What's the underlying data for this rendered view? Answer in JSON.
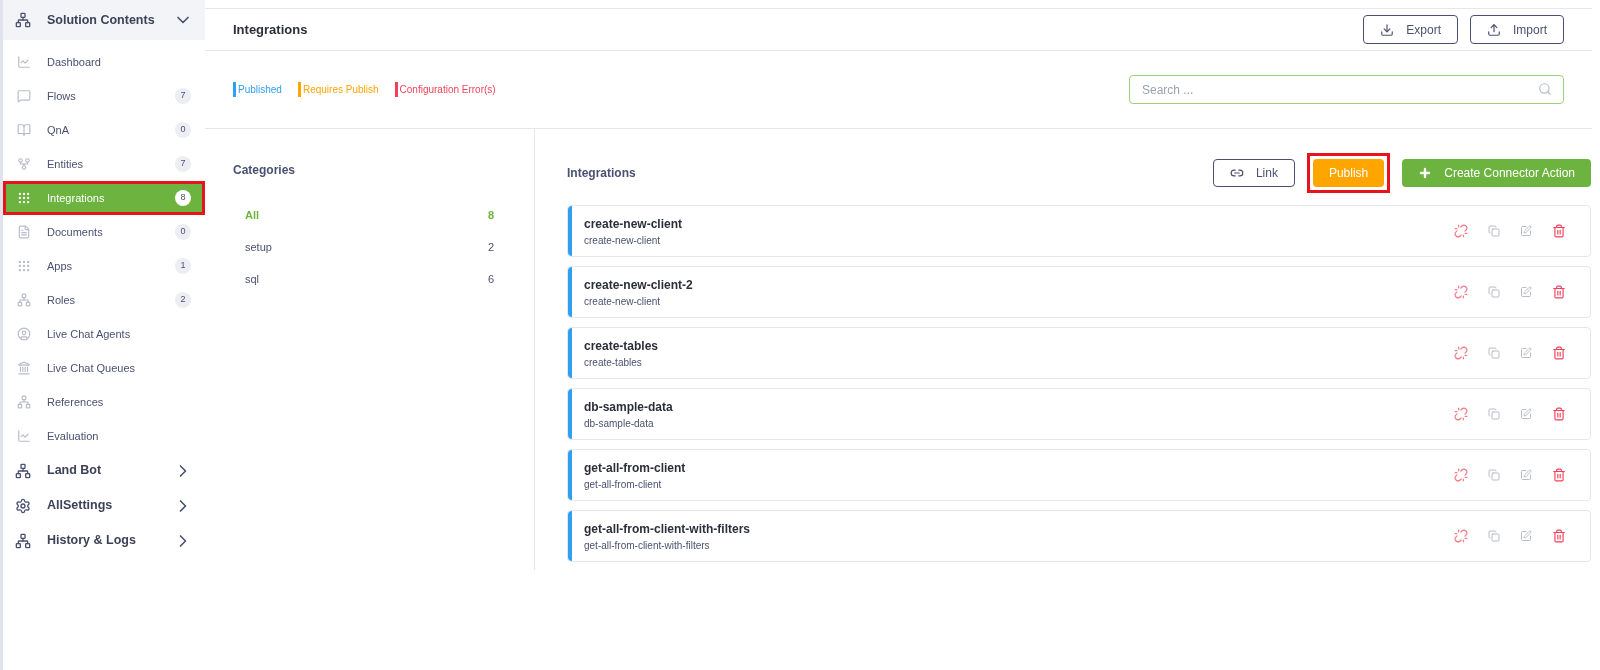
{
  "sidebar": {
    "sections": [
      {
        "title": "Solution Contents",
        "expanded": true,
        "items": [
          {
            "label": "Dashboard",
            "selected": false,
            "highlighted": false
          },
          {
            "label": "Flows",
            "count": "7",
            "selected": false,
            "highlighted": false
          },
          {
            "label": "QnA",
            "count": "0",
            "selected": false,
            "highlighted": false
          },
          {
            "label": "Entities",
            "count": "7",
            "selected": false,
            "highlighted": false
          },
          {
            "label": "Integrations",
            "count": "8",
            "selected": true,
            "highlighted": true
          },
          {
            "label": "Documents",
            "count": "0",
            "selected": false,
            "highlighted": false
          },
          {
            "label": "Apps",
            "count": "1",
            "selected": false,
            "highlighted": false
          },
          {
            "label": "Roles",
            "count": "2",
            "selected": false,
            "highlighted": false
          },
          {
            "label": "Live Chat Agents",
            "selected": false,
            "highlighted": false
          },
          {
            "label": "Live Chat Queues",
            "selected": false,
            "highlighted": false
          },
          {
            "label": "References",
            "selected": false,
            "highlighted": false
          },
          {
            "label": "Evaluation",
            "selected": false,
            "highlighted": false
          }
        ]
      },
      {
        "title": "Land Bot",
        "expanded": false
      },
      {
        "title": "AllSettings",
        "expanded": false
      },
      {
        "title": "History & Logs",
        "expanded": false
      }
    ]
  },
  "header": {
    "title": "Integrations",
    "buttons": [
      "Export",
      "Import"
    ]
  },
  "legend": [
    {
      "label": "Published",
      "color": "#2f9ff2"
    },
    {
      "label": "Requires Publish",
      "color": "#ffa500"
    },
    {
      "label": "Configuration Error(s)",
      "color": "#f0435a"
    }
  ],
  "search": {
    "placeholder": "Search ..."
  },
  "categories": {
    "title": "Categories",
    "items": [
      {
        "label": "All",
        "count": "8",
        "selected": true
      },
      {
        "label": "setup",
        "count": "2",
        "selected": false
      },
      {
        "label": "sql",
        "count": "6",
        "selected": false
      }
    ]
  },
  "integrations": {
    "title": "Integrations",
    "actions": [
      {
        "label": "Link",
        "kind": "outline",
        "highlighted": false
      },
      {
        "label": "Publish",
        "kind": "warning",
        "highlighted": true
      },
      {
        "label": "Create Connector Action",
        "kind": "primary",
        "highlighted": false
      }
    ],
    "items": [
      {
        "name": "create-new-client",
        "subtitle": "create-new-client",
        "color": "#2f9ff2"
      },
      {
        "name": "create-new-client-2",
        "subtitle": "create-new-client",
        "color": "#2f9ff2"
      },
      {
        "name": "create-tables",
        "subtitle": "create-tables",
        "color": "#2f9ff2"
      },
      {
        "name": "db-sample-data",
        "subtitle": "db-sample-data",
        "color": "#2f9ff2"
      },
      {
        "name": "get-all-from-client",
        "subtitle": "get-all-from-client",
        "color": "#2f9ff2"
      },
      {
        "name": "get-all-from-client-with-filters",
        "subtitle": "get-all-from-client-with-filters",
        "color": "#2f9ff2"
      }
    ]
  }
}
